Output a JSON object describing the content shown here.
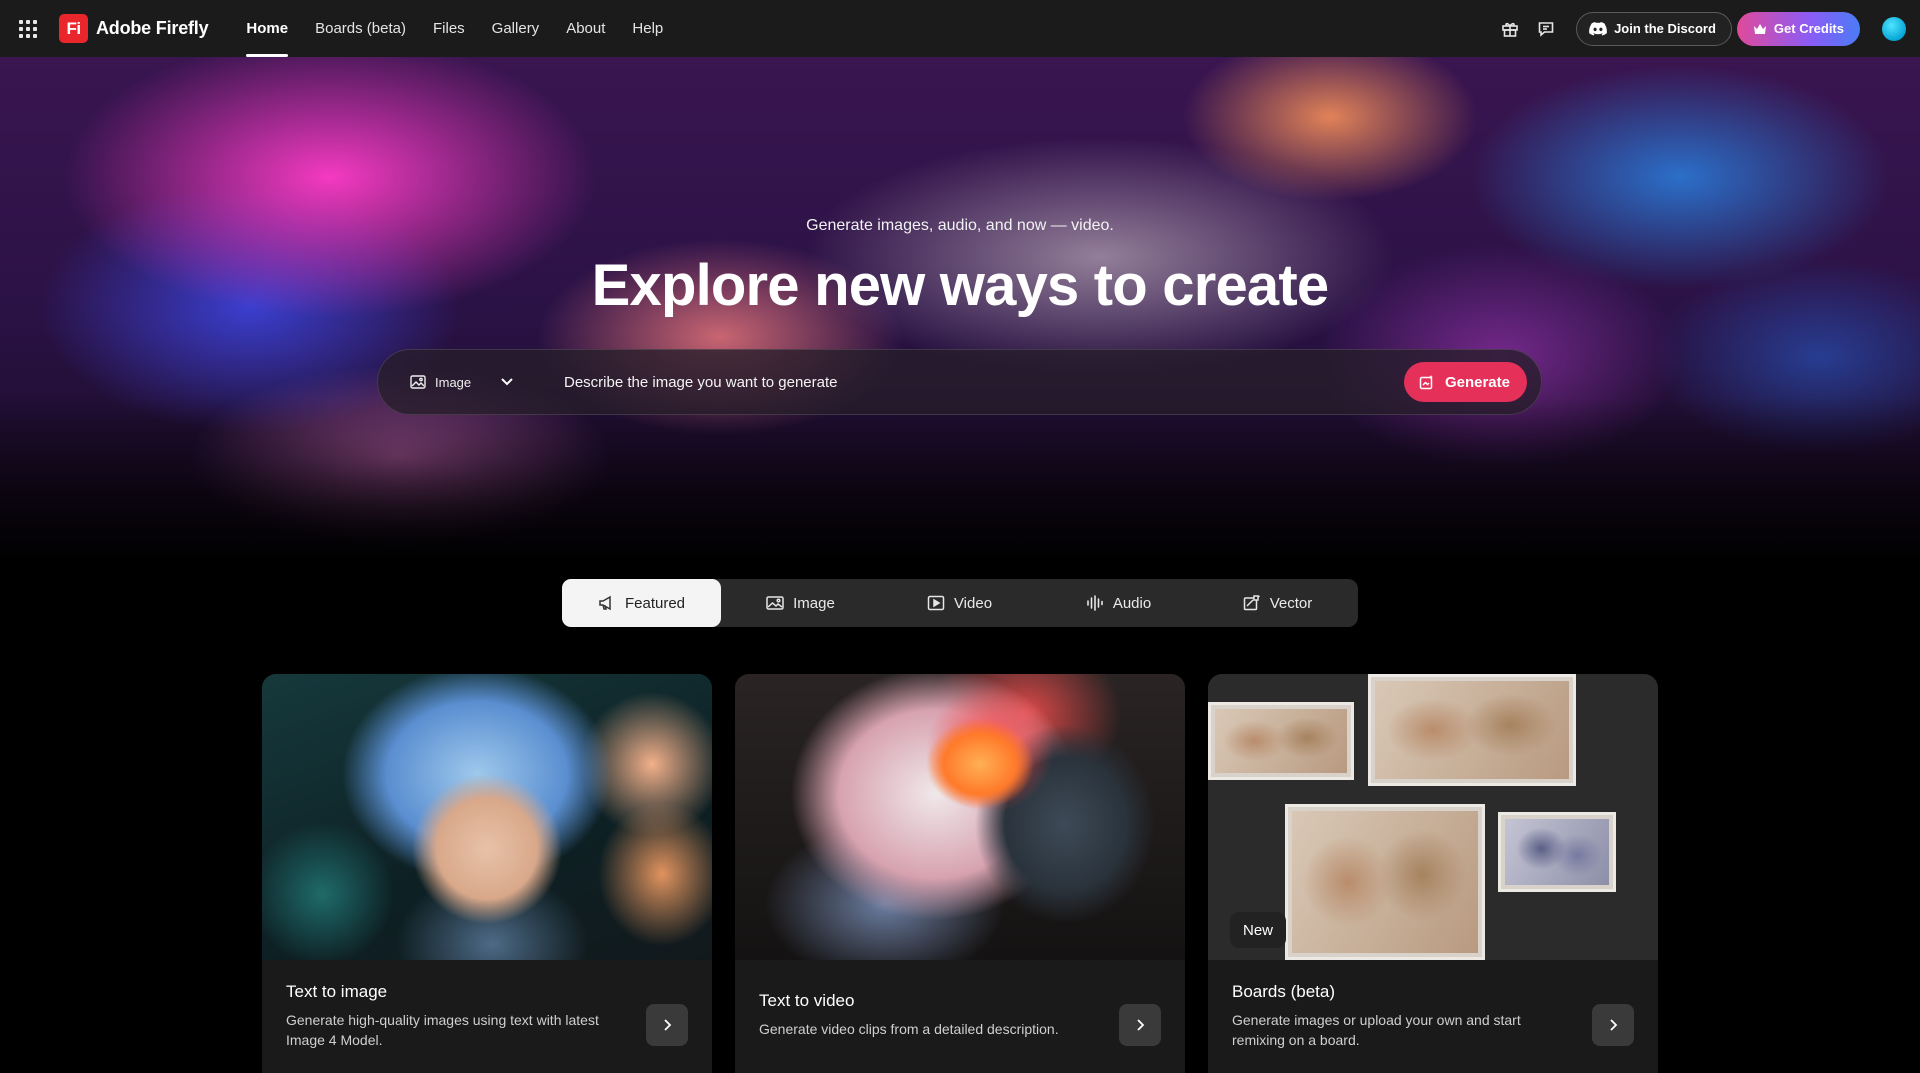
{
  "app": {
    "brand_logo": "Fi",
    "brand_name": "Adobe Firefly",
    "accent": "#e5305a"
  },
  "nav": [
    {
      "label": "Home",
      "active": true
    },
    {
      "label": "Boards (beta)",
      "active": false
    },
    {
      "label": "Files",
      "active": false
    },
    {
      "label": "Gallery",
      "active": false
    },
    {
      "label": "About",
      "active": false
    },
    {
      "label": "Help",
      "active": false
    }
  ],
  "topright": {
    "gift_icon": "gift-icon",
    "feedback_icon": "chat-icon",
    "discord_label": "Join the Discord",
    "credits_label": "Get Credits"
  },
  "hero": {
    "subtitle": "Generate images, audio, and now — video.",
    "title": "Explore new ways to create",
    "prompt": {
      "type_label": "Image",
      "placeholder": "Describe the image you want to generate",
      "generate_label": "Generate"
    }
  },
  "tabs": [
    {
      "label": "Featured",
      "icon": "megaphone-icon",
      "active": true
    },
    {
      "label": "Image",
      "icon": "image-icon",
      "active": false
    },
    {
      "label": "Video",
      "icon": "video-icon",
      "active": false
    },
    {
      "label": "Audio",
      "icon": "audio-icon",
      "active": false
    },
    {
      "label": "Vector",
      "icon": "vector-icon",
      "active": false
    }
  ],
  "cards": [
    {
      "title": "Text to image",
      "desc": "Generate high-quality images using text with latest Image 4 Model.",
      "badge": ""
    },
    {
      "title": "Text to video",
      "desc": "Generate video clips from a detailed description.",
      "badge": ""
    },
    {
      "title": "Boards (beta)",
      "desc": "Generate images or upload your own and start remixing on a board.",
      "badge": "New"
    }
  ]
}
